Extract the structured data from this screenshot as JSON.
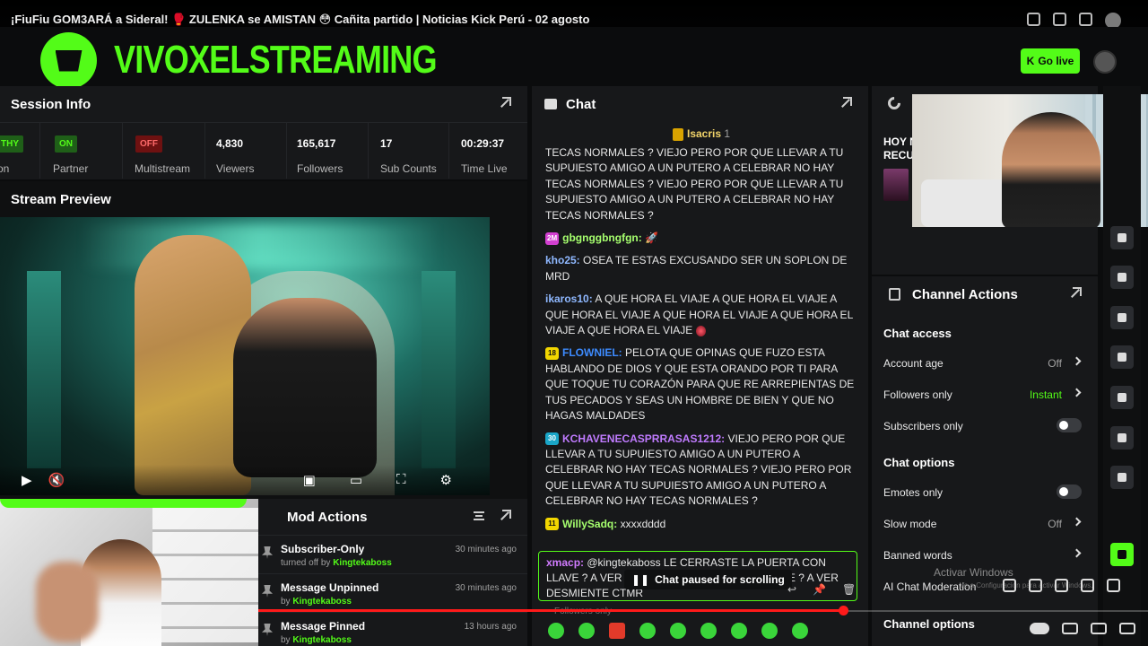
{
  "yt_title": "¡FiuFiu GOM3ARÁ a Sideral! 🥊 ZULENKA se AMISTAN 😳 Cañita partido | Noticias Kick Perú - 02 agosto",
  "brand": "VIVOXELSTREAMING",
  "header": {
    "go_live": "Go live"
  },
  "session": {
    "title": "Session Info",
    "partial_pill": "THY",
    "partial_label": "on",
    "partner_pill": "ON",
    "partner_label": "Partner",
    "multistream_pill": "OFF",
    "multistream_label": "Multistream",
    "viewers": "4,830",
    "viewers_label": "Viewers",
    "followers": "165,617",
    "followers_label": "Followers",
    "subs": "17",
    "subs_label": "Sub Counts",
    "time": "00:29:37",
    "time_label": "Time Live"
  },
  "preview": {
    "title": "Stream Preview"
  },
  "mod": {
    "title": "Mod Actions",
    "items": [
      {
        "action": "Subscriber-Only",
        "by_prefix": "turned off by",
        "by": "Kingtekaboss",
        "time": "30 minutes ago"
      },
      {
        "action": "Message Unpinned",
        "by_prefix": "by",
        "by": "Kingtekaboss",
        "time": "30 minutes ago"
      },
      {
        "action": "Message Pinned",
        "by_prefix": "by",
        "by": "Kingtekaboss",
        "time": "13 hours ago"
      }
    ]
  },
  "chat": {
    "title": "Chat",
    "pinned_user": "Isacris",
    "pinned_count": "1",
    "messages": [
      {
        "badge": "",
        "user": "",
        "text": "TECAS NORMALES ? VIEJO PERO POR QUE LLEVAR A TU SUPUIESTO AMIGO A UN PUTERO A CELEBRAR NO HAY TECAS NORMALES ? VIEJO PERO POR QUE LLEVAR A TU SUPUIESTO AMIGO A UN PUTERO A CELEBRAR NO HAY TECAS NORMALES ?"
      },
      {
        "badge": "2M",
        "user": "gbgnggbngfgn:",
        "text": ""
      },
      {
        "badge": "",
        "user": "kho25:",
        "text": "OSEA TE ESTAS EXCUSANDO SER UN SOPLON DE MRD"
      },
      {
        "badge": "",
        "user": "ikaros10:",
        "text": "A QUE HORA EL VIAJE A QUE HORA EL VIAJE A QUE HORA EL VIAJE A QUE HORA EL VIAJE A QUE HORA EL VIAJE A QUE HORA EL VIAJE"
      },
      {
        "badge": "18",
        "user": "FLOWNIEL:",
        "text": "PELOTA QUE OPINAS QUE FUZO ESTA HABLANDO DE DIOS Y QUE ESTA ORANDO POR TI PARA QUE TOQUE TU CORAZÓN PARA QUE RE ARREPIENTAS DE TUS PECADOS Y SEAS UN HOMBRE DE BIEN Y QUE NO HAGAS MALDADES"
      },
      {
        "badge": "30",
        "user": "KCHAVENECASPRRASAS1212:",
        "text": "VIEJO PERO POR QUE LLEVAR A TU SUPUIESTO AMIGO A UN PUTERO A CELEBRAR NO HAY TECAS NORMALES ? VIEJO PERO POR QUE LLEVAR A TU SUPUIESTO AMIGO A UN PUTERO A CELEBRAR NO HAY TECAS NORMALES ?"
      },
      {
        "badge": "11",
        "user": "WillySadq:",
        "text": "xxxxdddd"
      }
    ],
    "reply_user": "xmacp:",
    "reply_text": "@kingtekaboss LE CERRASTE LA PUERTA CON LLAVE ? A VER D... ASTE LA PUERTA CON LLAVE ? A VER DESMIENTE CTMR",
    "paused": "Chat paused for scrolling",
    "followers_only": "Followers only"
  },
  "right_top": {
    "hoy": "HOY N RECUI"
  },
  "actions": {
    "title": "Channel Actions",
    "chat_access": "Chat access",
    "account_age": "Account age",
    "account_age_val": "Off",
    "followers_only": "Followers only",
    "followers_only_val": "Instant",
    "subscribers_only": "Subscribers only",
    "chat_options": "Chat options",
    "emotes_only": "Emotes only",
    "slow_mode": "Slow mode",
    "slow_mode_val": "Off",
    "banned_words": "Banned words",
    "ai_mod": "AI Chat Moderation",
    "channel_options": "Channel options"
  },
  "watermark": "Activar Windows",
  "watermark2": "Ve a Configuración para activar Windows."
}
